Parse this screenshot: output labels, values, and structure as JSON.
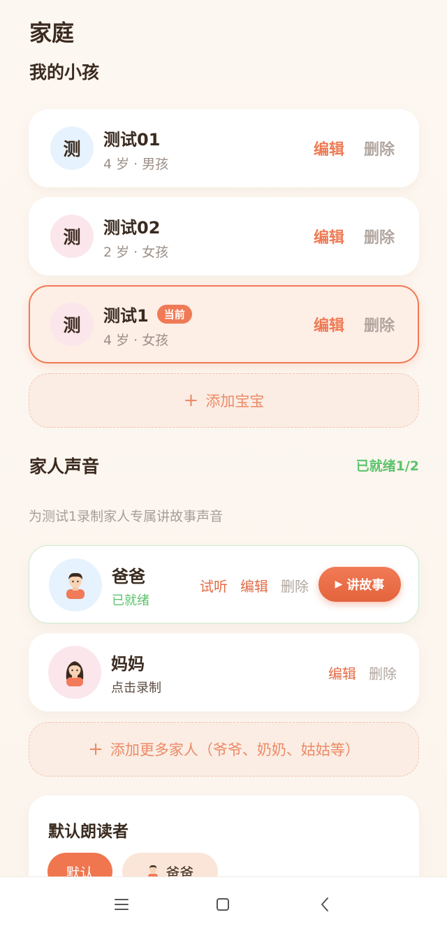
{
  "page": {
    "title": "家庭"
  },
  "kids": {
    "section_title": "我的小孩",
    "items": [
      {
        "avatar": "测",
        "name": "测试01",
        "info": "4 岁 · 男孩",
        "edit": "编辑",
        "delete": "删除"
      },
      {
        "avatar": "测",
        "name": "测试02",
        "info": "2 岁 · 女孩",
        "edit": "编辑",
        "delete": "删除"
      },
      {
        "avatar": "测",
        "name": "测试1",
        "badge": "当前",
        "info": "4 岁 · 女孩",
        "edit": "编辑",
        "delete": "删除"
      }
    ],
    "add_label": "添加宝宝"
  },
  "voices": {
    "section_title": "家人声音",
    "ready_count": "已就绪1/2",
    "subtitle": "为测试1录制家人专属讲故事声音",
    "items": [
      {
        "name": "爸爸",
        "status": "已就绪",
        "listen": "试听",
        "edit": "编辑",
        "delete": "删除",
        "story": "讲故事"
      },
      {
        "name": "妈妈",
        "status": "点击录制",
        "edit": "编辑",
        "delete": "删除"
      }
    ],
    "add_label": "添加更多家人（爷爷、奶奶、姑姑等）"
  },
  "reader": {
    "title": "默认朗读者",
    "chips": [
      "默认",
      "爸爸"
    ]
  },
  "colors": {
    "accent": "#ef7a55",
    "ready": "#5cc36c",
    "background": "#fdf6ef"
  },
  "navbar": {
    "icons": [
      "menu-icon",
      "home-square-icon",
      "back-chevron-icon"
    ]
  }
}
